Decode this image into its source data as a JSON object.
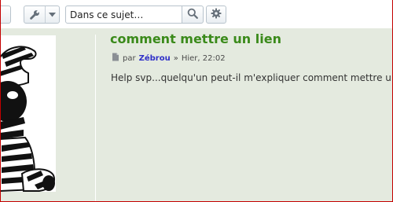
{
  "toolbar": {
    "tools_icon": "wrench-icon",
    "dropdown_icon": "caret-down-icon",
    "search": {
      "value": "Dans ce sujet…"
    },
    "search_icon": "search-icon",
    "advanced_icon": "gear-icon"
  },
  "post": {
    "title": "comment mettre un lien",
    "meta": {
      "icon": "post-icon",
      "prefix": "par",
      "author": "Zébrou",
      "separator": "»",
      "time": "Hier, 22:02"
    },
    "body": "Help svp...quelqu'un peut-il m'expliquer comment mettre un"
  },
  "colors": {
    "post_bg": "#e4eadf",
    "title": "#3a8a1a",
    "author": "#2f2fc8",
    "frame_border": "#c40000"
  }
}
